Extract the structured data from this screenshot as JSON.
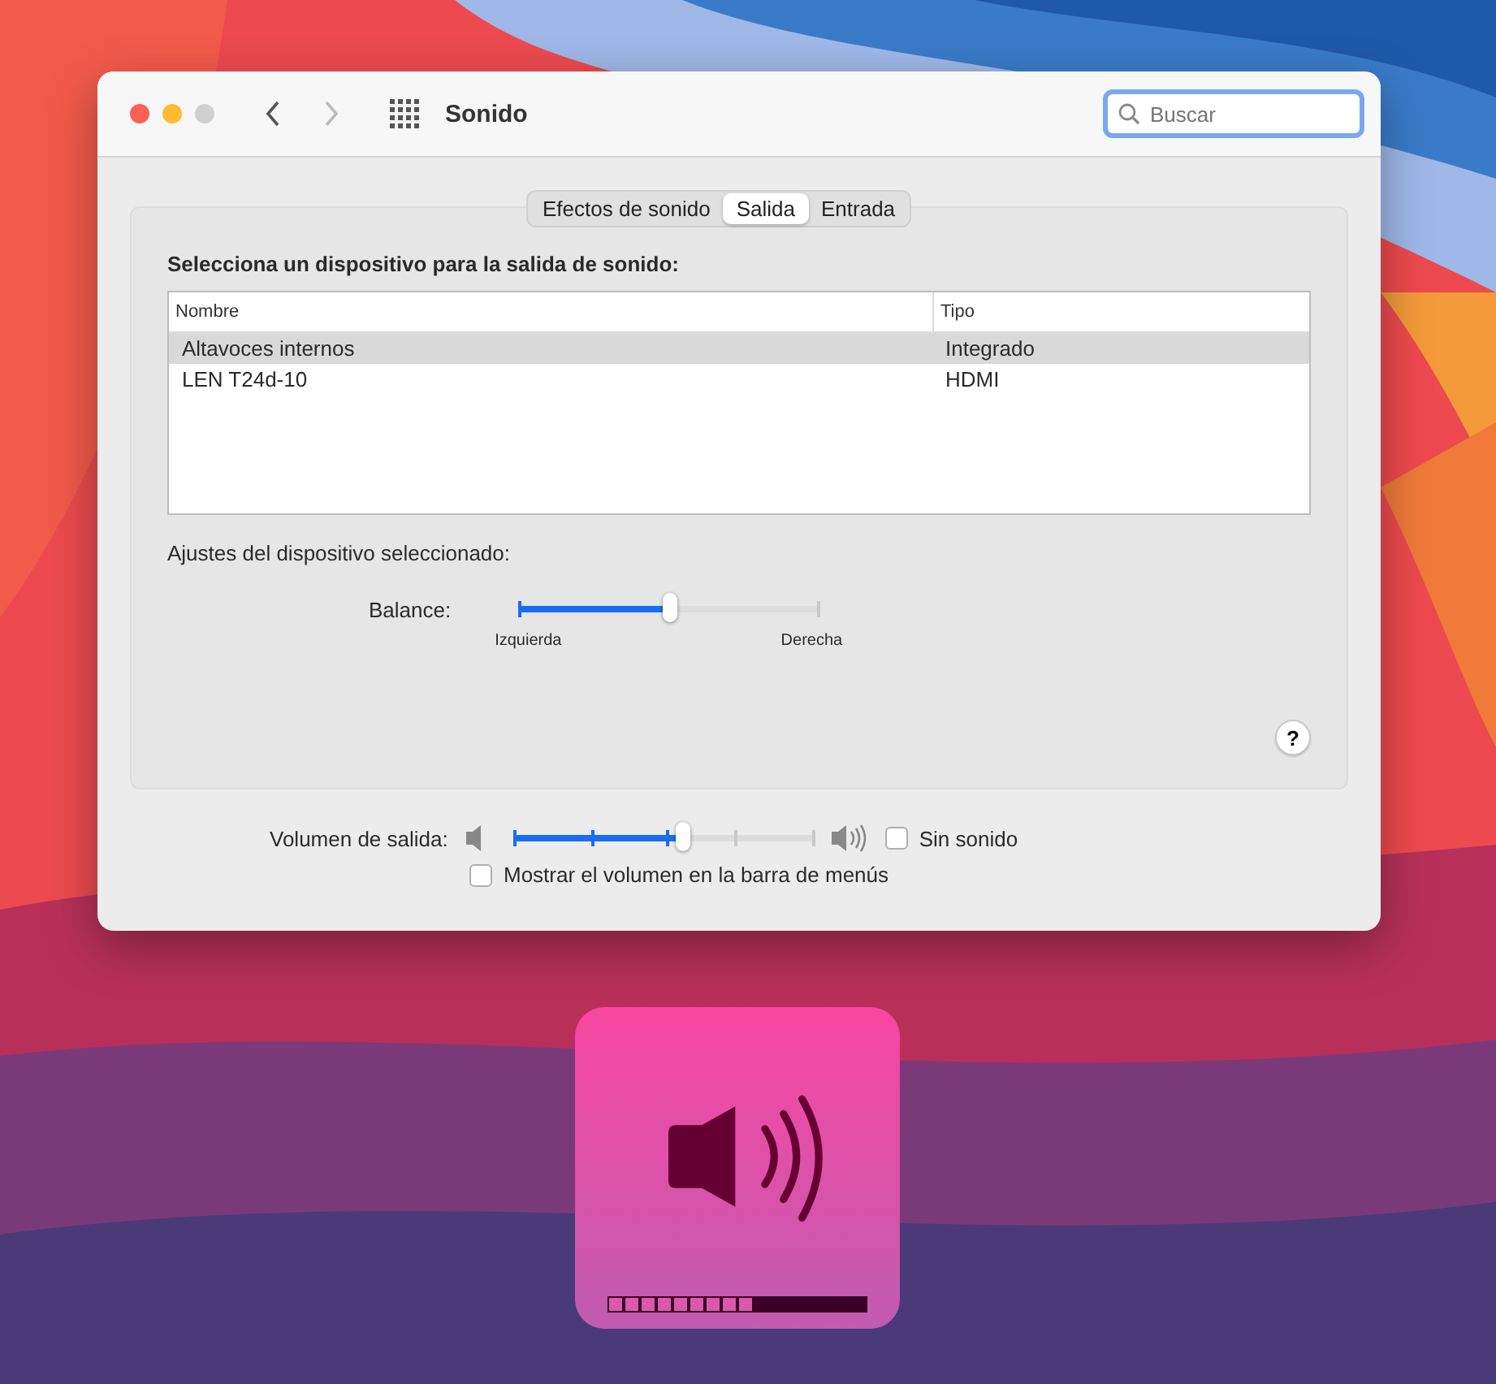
{
  "window": {
    "title": "Sonido",
    "search": {
      "placeholder": "Buscar"
    }
  },
  "tabs": [
    {
      "label": "Efectos de sonido",
      "selected": false
    },
    {
      "label": "Salida",
      "selected": true
    },
    {
      "label": "Entrada",
      "selected": false
    }
  ],
  "output": {
    "heading": "Selecciona un dispositivo para la salida de sonido:",
    "columns": [
      "Nombre",
      "Tipo"
    ],
    "rows": [
      {
        "cells": [
          "Altavoces internos",
          "Integrado"
        ],
        "selected": true
      },
      {
        "cells": [
          "LEN T24d-10",
          "HDMI"
        ],
        "selected": false
      }
    ],
    "settings_label": "Ajustes del dispositivo seleccionado:",
    "balance": {
      "label": "Balance:",
      "level": 0.5,
      "left": "Izquierda",
      "right": "Derecha"
    },
    "help": "?"
  },
  "volume": {
    "label": "Volumen de salida:",
    "level": 0.56,
    "mute": {
      "label": "Sin sonido",
      "checked": false
    },
    "show_in_menu_bar": {
      "label": "Mostrar el volumen en la barra de menús",
      "checked": false
    }
  },
  "hud": {
    "level": 0.5625
  }
}
